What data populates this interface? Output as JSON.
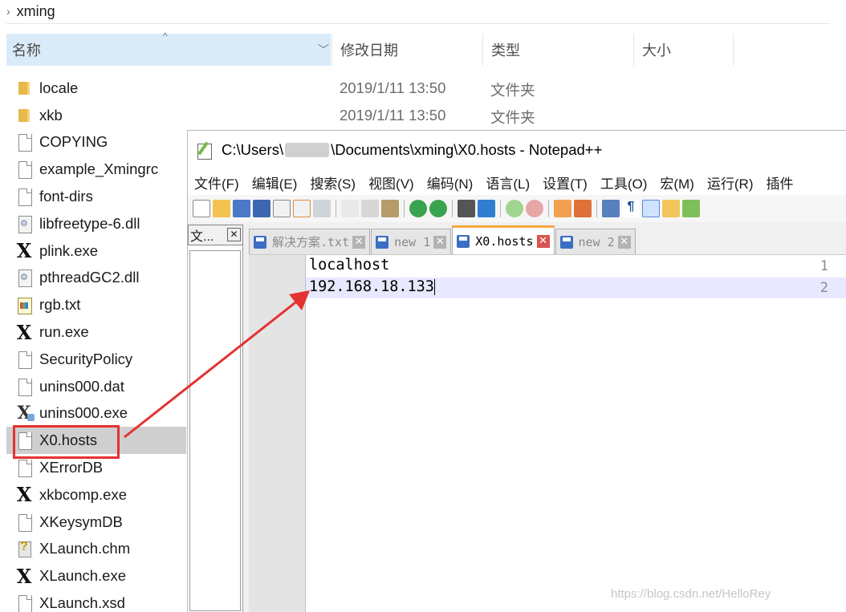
{
  "explorer": {
    "breadcrumb": "xming",
    "columns": {
      "name": "名称",
      "date": "修改日期",
      "type": "类型",
      "size": "大小"
    },
    "files": [
      {
        "name": "locale",
        "icon": "folder-icon",
        "date": "2019/1/11 13:50",
        "type": "文件夹"
      },
      {
        "name": "xkb",
        "icon": "folder-icon",
        "date": "2019/1/11 13:50",
        "type": "文件夹"
      },
      {
        "name": "COPYING",
        "icon": "file-icon"
      },
      {
        "name": "example_Xmingrc",
        "icon": "file-icon"
      },
      {
        "name": "font-dirs",
        "icon": "file-icon"
      },
      {
        "name": "libfreetype-6.dll",
        "icon": "dll-icon"
      },
      {
        "name": "plink.exe",
        "icon": "xming-exe-icon"
      },
      {
        "name": "pthreadGC2.dll",
        "icon": "dll-icon"
      },
      {
        "name": "rgb.txt",
        "icon": "text-file-icon"
      },
      {
        "name": "run.exe",
        "icon": "xming-exe-icon"
      },
      {
        "name": "SecurityPolicy",
        "icon": "file-icon"
      },
      {
        "name": "unins000.dat",
        "icon": "file-icon"
      },
      {
        "name": "unins000.exe",
        "icon": "uninstaller-icon"
      },
      {
        "name": "X0.hosts",
        "icon": "file-icon",
        "selected": true
      },
      {
        "name": "XErrorDB",
        "icon": "file-icon"
      },
      {
        "name": "xkbcomp.exe",
        "icon": "xming-exe-icon"
      },
      {
        "name": "XKeysymDB",
        "icon": "file-icon"
      },
      {
        "name": "XLaunch.chm",
        "icon": "help-file-icon"
      },
      {
        "name": "XLaunch.exe",
        "icon": "xming-exe-icon"
      },
      {
        "name": "XLaunch.xsd",
        "icon": "file-icon"
      }
    ]
  },
  "notepad": {
    "title_prefix": "C:\\Users\\",
    "title_suffix": "\\Documents\\xming\\X0.hosts - Notepad++",
    "menu": [
      "文件(F)",
      "编辑(E)",
      "搜索(S)",
      "视图(V)",
      "编码(N)",
      "语言(L)",
      "设置(T)",
      "工具(O)",
      "宏(M)",
      "运行(R)",
      "插件"
    ],
    "side_panel_label": "文...",
    "tabs": [
      {
        "label": "解决方案.txt",
        "active": false
      },
      {
        "label": "new 1",
        "active": false
      },
      {
        "label": "X0.hosts",
        "active": true
      },
      {
        "label": "new 2",
        "active": false
      }
    ],
    "lines": [
      {
        "num": "1",
        "text": "localhost"
      },
      {
        "num": "2",
        "text": "192.168.18.133"
      }
    ]
  },
  "watermark": "https://blog.csdn.net/HelloRey",
  "colors": {
    "selection": "#cfcfcf",
    "header_highlight": "#d9ebf9",
    "annotation_red": "#e53232",
    "active_tab_accent": "#f6a740",
    "current_line": "#e8e8ff"
  }
}
